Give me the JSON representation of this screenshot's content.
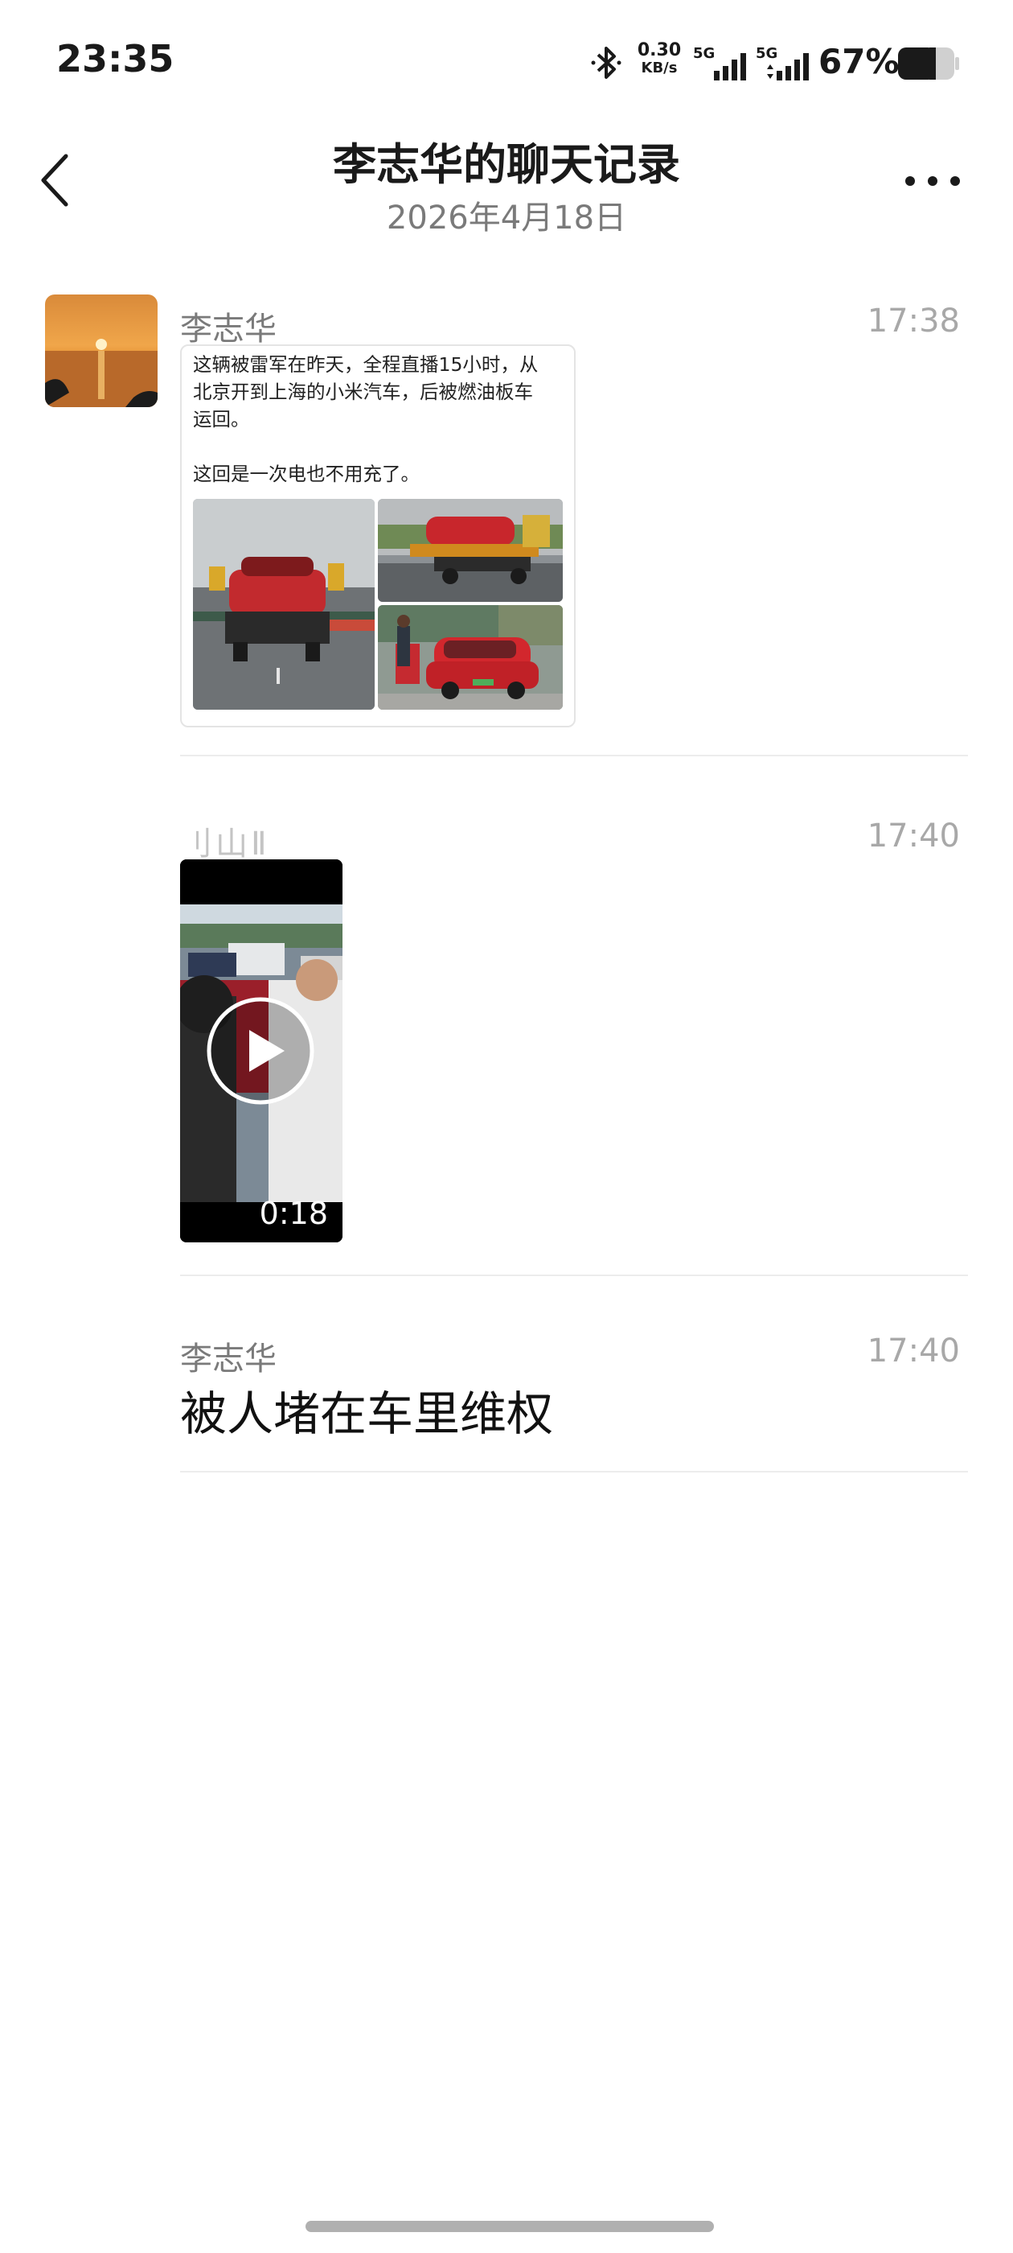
{
  "status_bar": {
    "time": "23:35",
    "network_speed_value": "0.30",
    "network_speed_unit": "KB/s",
    "signal_1_label": "5G",
    "signal_2_label": "5G",
    "battery_percent": "67%",
    "battery_level": 0.67,
    "icons": [
      "bluetooth-icon",
      "signal-icon",
      "signal-icon",
      "battery-icon"
    ]
  },
  "header": {
    "title": "李志华的聊天记录",
    "date": "2026年4月18日",
    "back_icon": "chevron-left-icon",
    "more_icon": "more-dots-icon"
  },
  "messages": [
    {
      "type": "card",
      "sender": "李志华",
      "time": "17:38",
      "card_text": "这辆被雷军在昨天，全程直播15小时，从\n北京开到上海的小米汽车，后被燃油板车\n运回。\n\n这回是一次电也不用充了。",
      "images": [
        "red-car-on-tow-truck-road",
        "red-car-on-tow-truck-side",
        "red-car-doors-open"
      ]
    },
    {
      "type": "video",
      "sender": "刂山Ⅱ",
      "time": "17:40",
      "duration": "0:18"
    },
    {
      "type": "text",
      "sender": "李志华",
      "time": "17:40",
      "text": "被人堵在车里维权"
    }
  ],
  "colors": {
    "background": "#ffffff",
    "secondary_text": "#7a7a7a",
    "time_text": "#a8a8a8",
    "divider": "#ececec"
  }
}
